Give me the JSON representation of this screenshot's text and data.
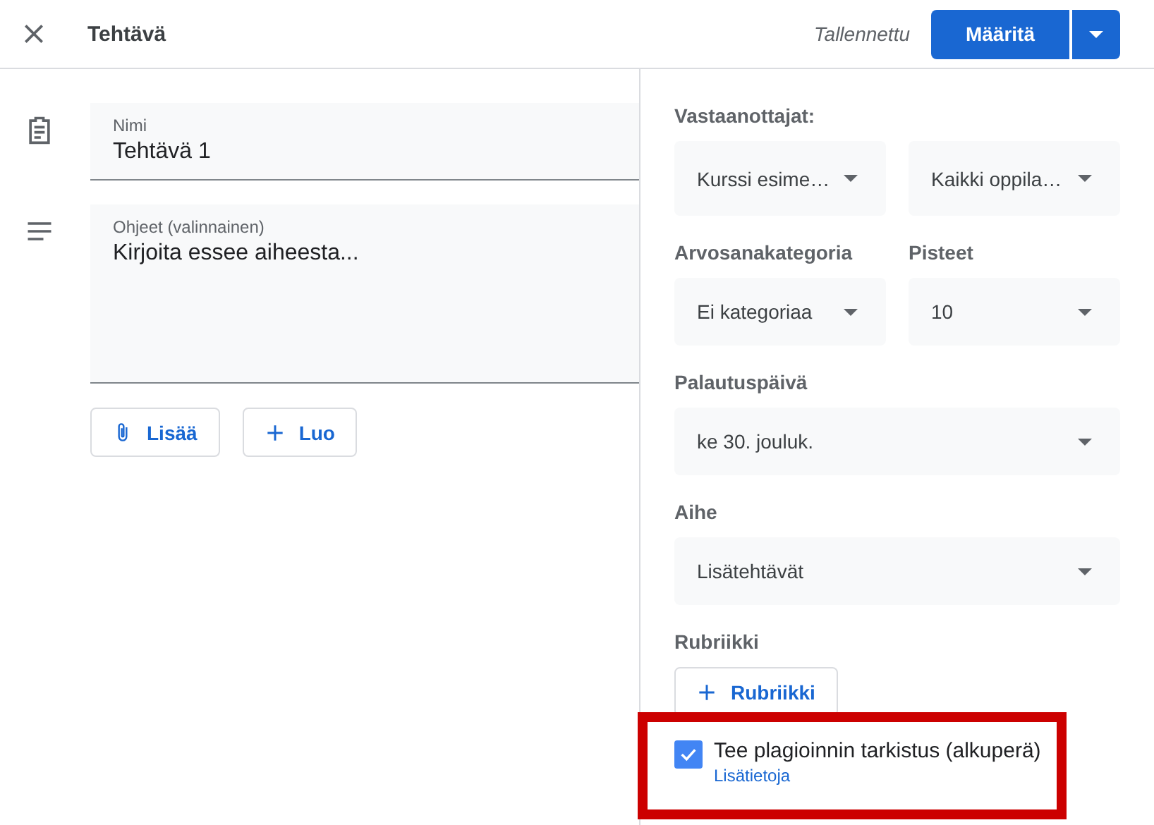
{
  "header": {
    "title": "Tehtävä",
    "status": "Tallennettu",
    "primary_button": "Määritä"
  },
  "fields": [
    {
      "kind": "single",
      "label": "Nimi",
      "value": "Tehtävä 1"
    },
    {
      "kind": "multi",
      "label": "Ohjeet (valinnainen)",
      "value": "Kirjoita essee aiheesta..."
    }
  ],
  "add_buttons": [
    {
      "kind": "attach",
      "label": "Lisää"
    },
    {
      "kind": "create",
      "label": "Luo"
    }
  ],
  "settings": [
    {
      "kind": "shared",
      "label": "Vastaanottajat:",
      "selects": [
        "Kurssi esime…",
        "Kaikki oppila…"
      ]
    },
    {
      "kind": "split",
      "columns": [
        {
          "label": "Arvosanakategoria",
          "value": "Ei kategoriaa"
        },
        {
          "label": "Pisteet",
          "value": "10"
        }
      ]
    },
    {
      "kind": "wide",
      "label": "Palautuspäivä",
      "value": "ke 30. jouluk."
    },
    {
      "kind": "wide",
      "label": "Aihe",
      "value": "Lisätehtävät"
    }
  ],
  "rubric": {
    "label": "Rubriikki",
    "button": "Rubriikki"
  },
  "plagiarism": {
    "checked": true,
    "label": "Tee plagioinnin tarkistus (alkuperä)",
    "link": "Lisätietoja"
  },
  "highlight_frame": true
}
